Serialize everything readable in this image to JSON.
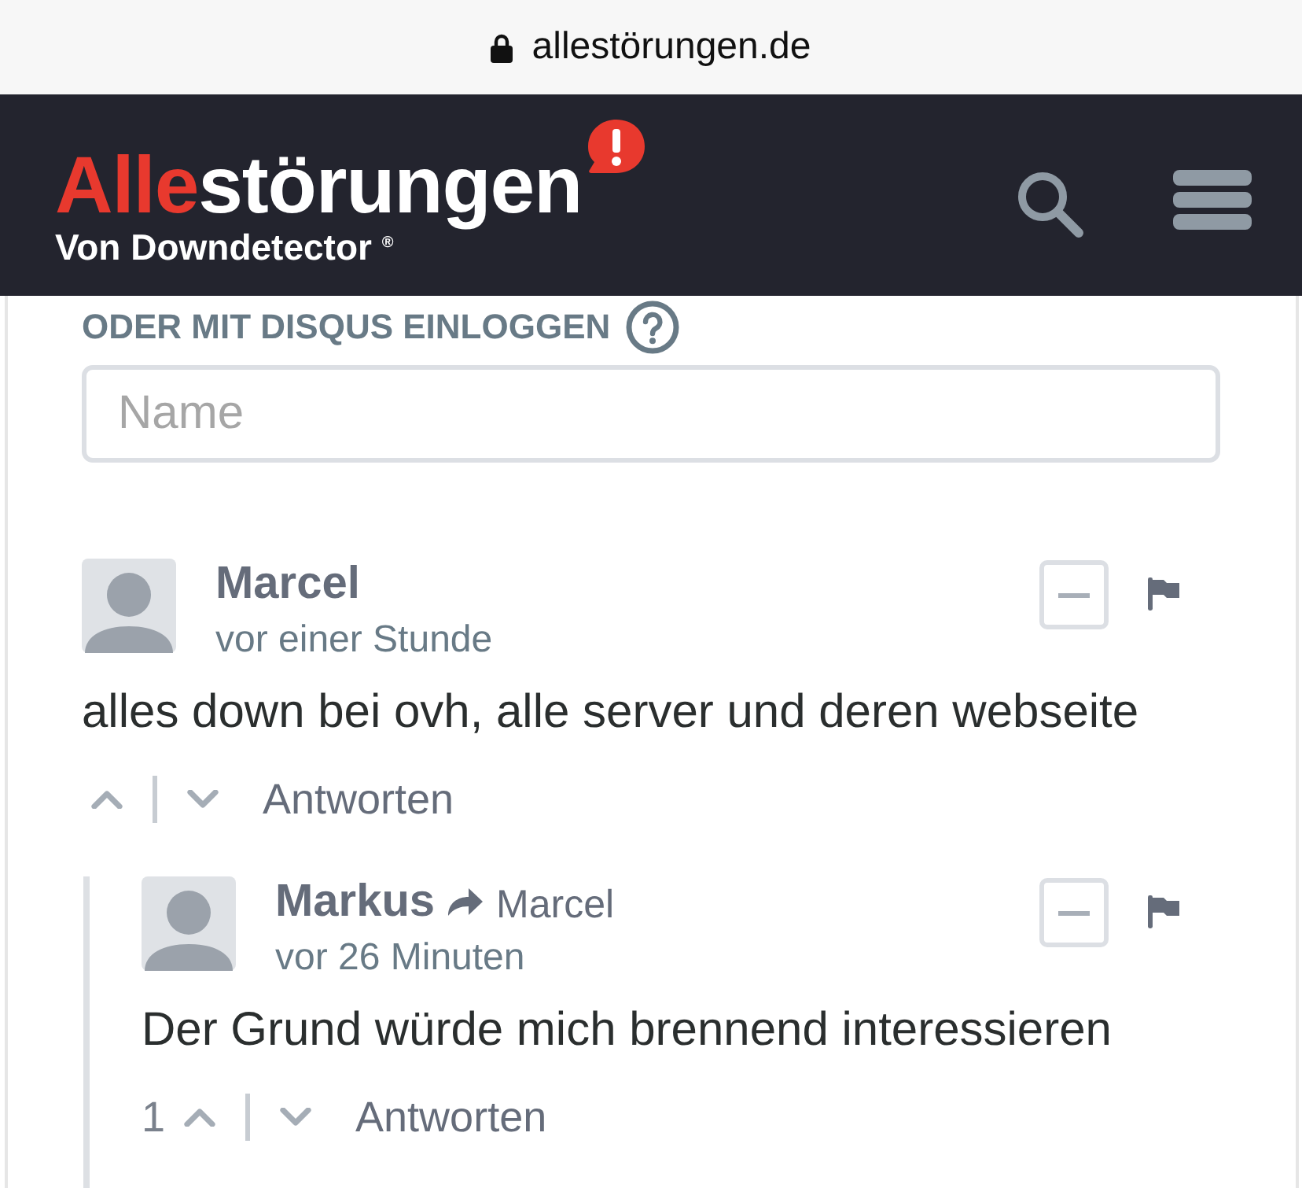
{
  "browser": {
    "url": "allestörungen.de",
    "secure": true
  },
  "header": {
    "logo": {
      "accent": "Alle",
      "rest": "störungen",
      "tagline": "Von Downdetector $^{®}$"
    }
  },
  "login": {
    "heading": "ODER MIT DISQUS EINLOGGEN",
    "name_field": {
      "placeholder": "Name"
    }
  },
  "comments": [
    {
      "author": "Marcel",
      "time": "vor einer Stunde",
      "text": "alles down bei ovh, alle server und deren webseite",
      "reply_label": "Antworten",
      "children": [
        {
          "author": "Markus",
          "reply_to": "Marcel",
          "time": "vor 26 Minuten",
          "text": "Der Grund würde mich brennend interessieren",
          "votes": "1",
          "reply_label": "Antworten"
        }
      ]
    }
  ]
}
